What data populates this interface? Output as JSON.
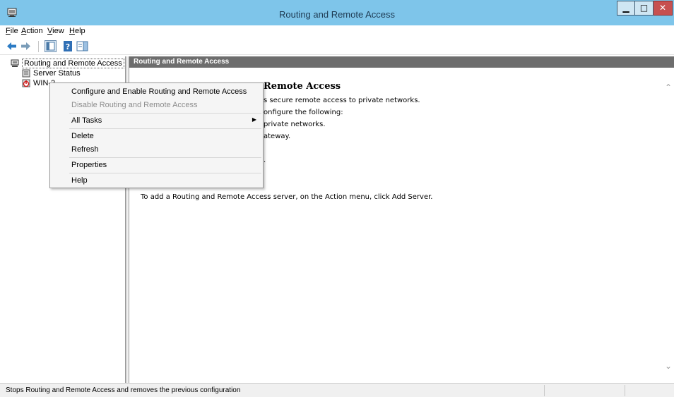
{
  "window": {
    "title": "Routing and Remote Access"
  },
  "menubar": {
    "items": [
      {
        "label": "File",
        "accel": "F",
        "rest": "ile"
      },
      {
        "label": "Action",
        "accel": "A",
        "rest": "ction"
      },
      {
        "label": "View",
        "accel": "V",
        "rest": "iew"
      },
      {
        "label": "Help",
        "accel": "H",
        "rest": "elp"
      }
    ]
  },
  "toolbar": {
    "icons": [
      "back-icon",
      "forward-icon",
      "show-hide-console-tree-icon",
      "help-icon",
      "show-hide-action-pane-icon"
    ]
  },
  "tree": {
    "root": "Routing and Remote Access",
    "items": [
      {
        "label": "Server Status",
        "icon": "server-status-icon"
      },
      {
        "label": "WIN-2",
        "icon": "server-stopped-icon"
      }
    ]
  },
  "content": {
    "header": "Routing and Remote Access",
    "title_fragment": "Remote Access",
    "lines": [
      "s secure remote access to private networks.",
      "onfigure the following:",
      "private networks.",
      "ateway.",
      "."
    ],
    "add_server_text": "To add a Routing and Remote Access server, on the Action menu, click Add Server."
  },
  "context_menu": {
    "items": [
      {
        "label": "Configure and Enable Routing and Remote Access",
        "enabled": true
      },
      {
        "label": "Disable Routing and Remote Access",
        "enabled": false
      },
      {
        "label": "All Tasks",
        "enabled": true,
        "submenu": true
      },
      {
        "label": "Delete",
        "enabled": true
      },
      {
        "label": "Refresh",
        "enabled": true
      },
      {
        "label": "Properties",
        "enabled": true
      },
      {
        "label": "Help",
        "enabled": true
      }
    ]
  },
  "statusbar": {
    "text": "Stops Routing and Remote Access and removes the previous configuration"
  },
  "colors": {
    "titlebar": "#7ec5ea",
    "content_header": "#6d6d6d",
    "close_button": "#c75050"
  }
}
